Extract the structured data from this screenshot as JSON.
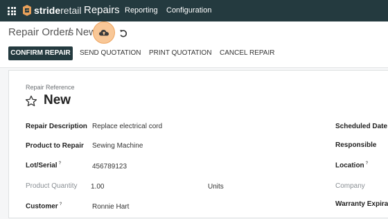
{
  "topnav": {
    "brand_bold": "stride",
    "brand_regular": "retail",
    "app_name": "Repairs",
    "menu": [
      "Reporting",
      "Configuration"
    ],
    "bg_color": "#243a3f",
    "apps_icon": "grid-icon",
    "logo_icon": "stride-logo-icon"
  },
  "breadcrumb": {
    "parent": "Repair Orders",
    "separator": "/",
    "current": "New",
    "save_icon": "cloud-upload-icon",
    "discard_icon": "undo-icon"
  },
  "actions": {
    "confirm": "CONFIRM REPAIR",
    "send": "SEND QUOTATION",
    "print": "PRINT QUOTATION",
    "cancel": "CANCEL REPAIR"
  },
  "form": {
    "reference_label": "Repair Reference",
    "reference_value": "New",
    "favorite_icon": "star-outline-icon",
    "fields_left": [
      {
        "label": "Repair Description",
        "value": "Replace electrical cord"
      },
      {
        "label": "Product to Repair",
        "value": "Sewing Machine"
      },
      {
        "label": "Lot/Serial",
        "help": "?",
        "value": "456789123"
      },
      {
        "label": "Product Quantity",
        "value": "1.00",
        "unit": "Units"
      },
      {
        "label": "Customer",
        "help": "?",
        "value": "Ronnie Hart"
      }
    ],
    "fields_right": [
      {
        "label": "Scheduled Date"
      },
      {
        "label": "Responsible"
      },
      {
        "label": "Location",
        "help": "?"
      },
      {
        "label": "Company"
      },
      {
        "label": "Warranty Expiration"
      }
    ]
  }
}
